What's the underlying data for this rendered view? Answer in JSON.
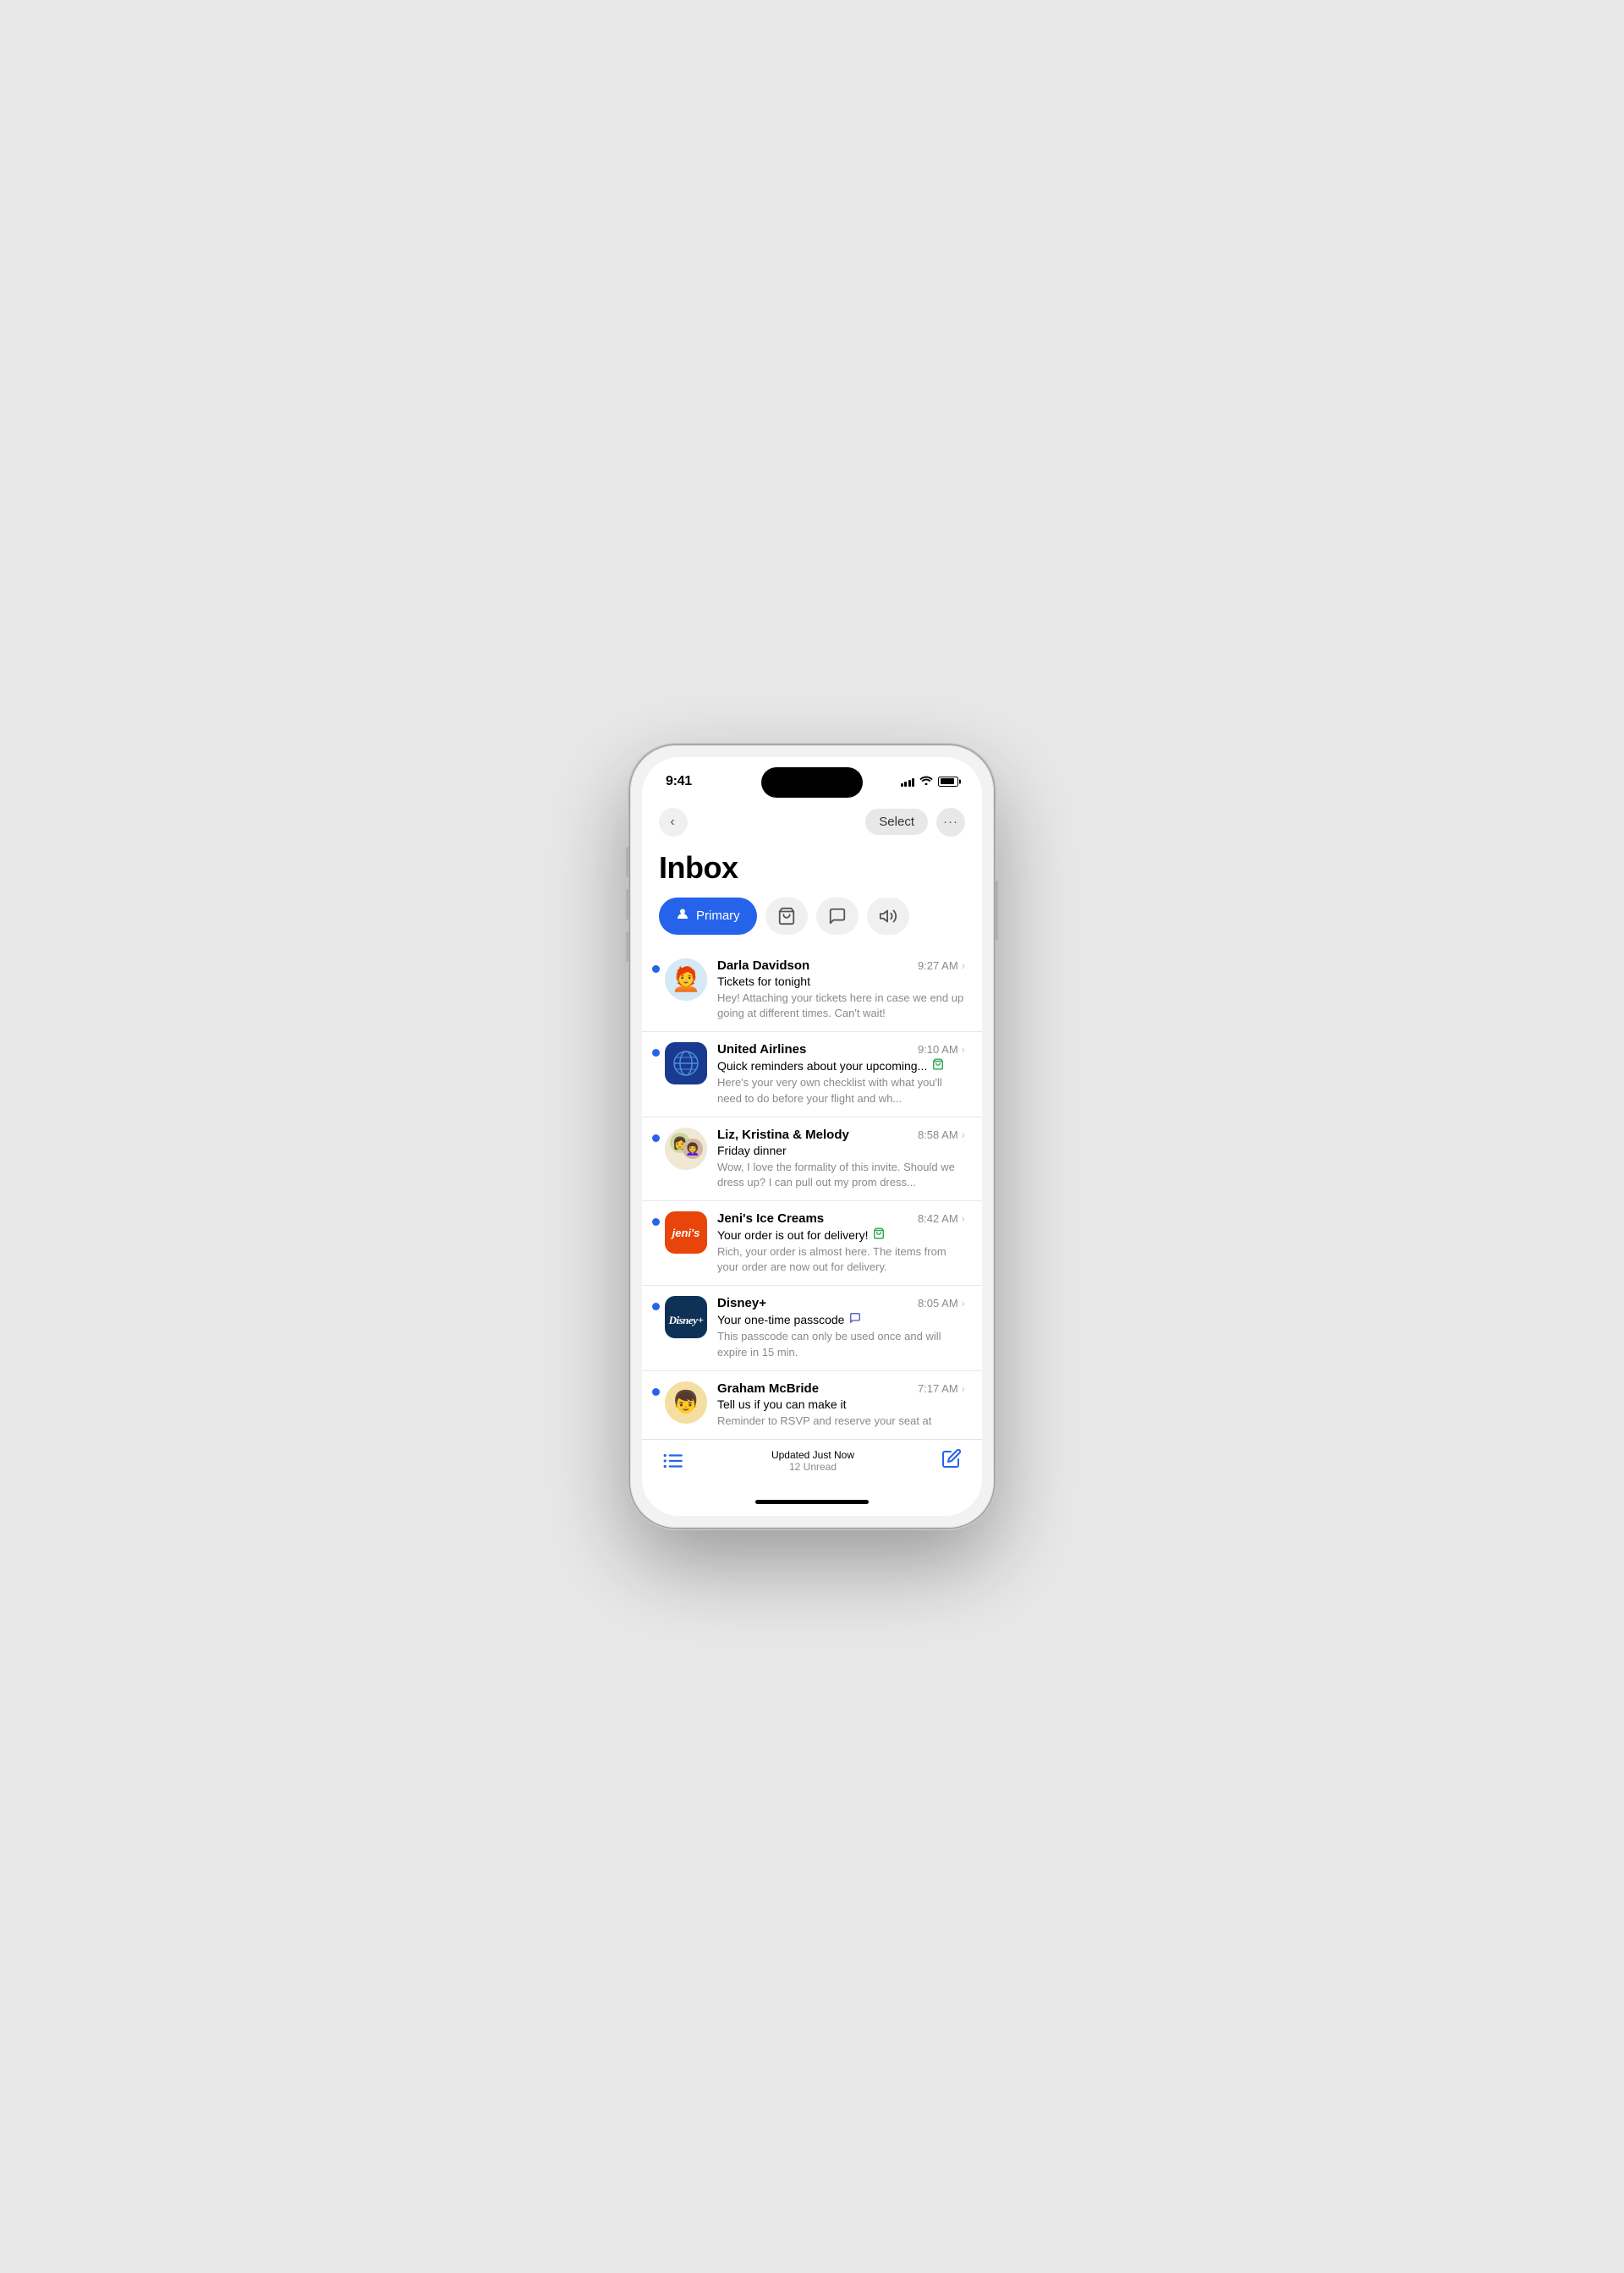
{
  "statusBar": {
    "time": "9:41",
    "signalBars": [
      4,
      6,
      8,
      10,
      12
    ],
    "wifiLabel": "wifi",
    "batteryLabel": "battery"
  },
  "nav": {
    "backLabel": "‹",
    "selectLabel": "Select",
    "moreLabel": "···"
  },
  "page": {
    "title": "Inbox"
  },
  "tabs": [
    {
      "id": "primary",
      "label": "Primary",
      "active": true
    },
    {
      "id": "shopping",
      "label": "Shopping",
      "active": false
    },
    {
      "id": "promotions",
      "label": "Promotions",
      "active": false
    },
    {
      "id": "updates",
      "label": "Updates",
      "active": false
    }
  ],
  "emails": [
    {
      "id": 1,
      "sender": "Darla Davidson",
      "subject": "Tickets for tonight",
      "preview": "Hey! Attaching your tickets here in case we end up going at different times. Can't wait!",
      "time": "9:27 AM",
      "unread": true,
      "avatarType": "emoji",
      "avatarEmoji": "🧑‍🦰",
      "avatarBg": "#d4e8f5",
      "avatarShape": "circle",
      "tag": null
    },
    {
      "id": 2,
      "sender": "United Airlines",
      "subject": "Quick reminders about your upcoming...",
      "preview": "Here's your very own checklist with what you'll need to do before your flight and wh...",
      "time": "9:10 AM",
      "unread": true,
      "avatarType": "globe",
      "avatarBg": "#1a3a8f",
      "avatarShape": "rounded",
      "tag": "shopping"
    },
    {
      "id": 3,
      "sender": "Liz, Kristina & Melody",
      "subject": "Friday dinner",
      "preview": "Wow, I love the formality of this invite. Should we dress up? I can pull out my prom dress...",
      "time": "8:58 AM",
      "unread": true,
      "avatarType": "emoji",
      "avatarEmoji": "👩‍🦱",
      "avatarBg": "#f0e8d4",
      "avatarShape": "circle",
      "tag": null
    },
    {
      "id": 4,
      "sender": "Jeni's Ice Creams",
      "subject": "Your order is out for delivery!",
      "preview": "Rich, your order is almost here. The items from your order are now out for delivery.",
      "time": "8:42 AM",
      "unread": true,
      "avatarType": "jenis",
      "avatarBg": "#e8450a",
      "avatarShape": "rounded",
      "tag": "shopping"
    },
    {
      "id": 5,
      "sender": "Disney+",
      "subject": "Your one-time passcode",
      "preview": "This passcode can only be used once and will expire in 15 min.",
      "time": "8:05 AM",
      "unread": true,
      "avatarType": "disney",
      "avatarBg": "#0e3157",
      "avatarShape": "rounded",
      "tag": "message"
    },
    {
      "id": 6,
      "sender": "Graham McBride",
      "subject": "Tell us if you can make it",
      "preview": "Reminder to RSVP and reserve your seat at",
      "time": "7:17 AM",
      "unread": true,
      "avatarType": "emoji",
      "avatarEmoji": "👦",
      "avatarBg": "#f5dfa0",
      "avatarShape": "circle",
      "tag": null
    }
  ],
  "bottomBar": {
    "updatedText": "Updated Just Now",
    "unreadText": "12 Unread"
  }
}
